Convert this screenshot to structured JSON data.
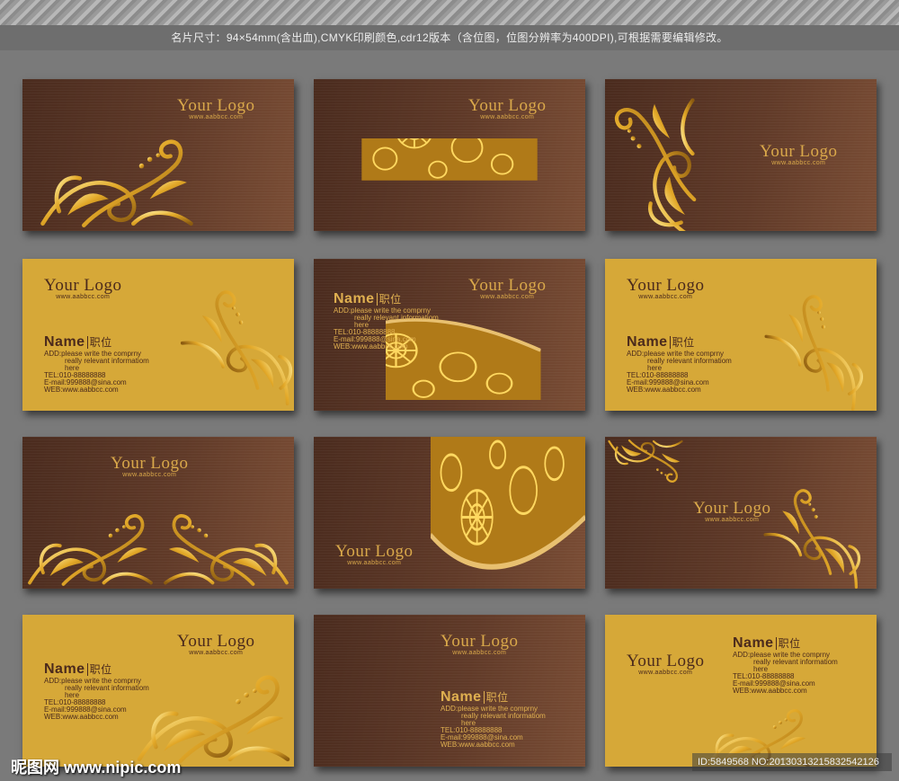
{
  "caption": "名片尺寸：94×54mm(含出血),CMYK印刷颜色,cdr12版本（含位图，位图分辨率为400DPI),可根据需要编辑修改。",
  "logo": {
    "text": "Your Logo",
    "url": "www.aabbcc.com"
  },
  "contact": {
    "name": "Name",
    "title": "职位",
    "add1": "ADD:please write the comprny",
    "add2": "really relevant informatiom",
    "add3": "here",
    "tel": "TEL:010-88888888",
    "email": "E-mail:999888@sina.com",
    "web": "WEB:www.aabbcc.com"
  },
  "watermark": "昵图网 www.nipic.com",
  "image_id": "ID:5849568 NO:20130313215832542126",
  "colors": {
    "brown": "#5a3526",
    "gold": "#d6a838",
    "ornament": "#e8b840"
  }
}
